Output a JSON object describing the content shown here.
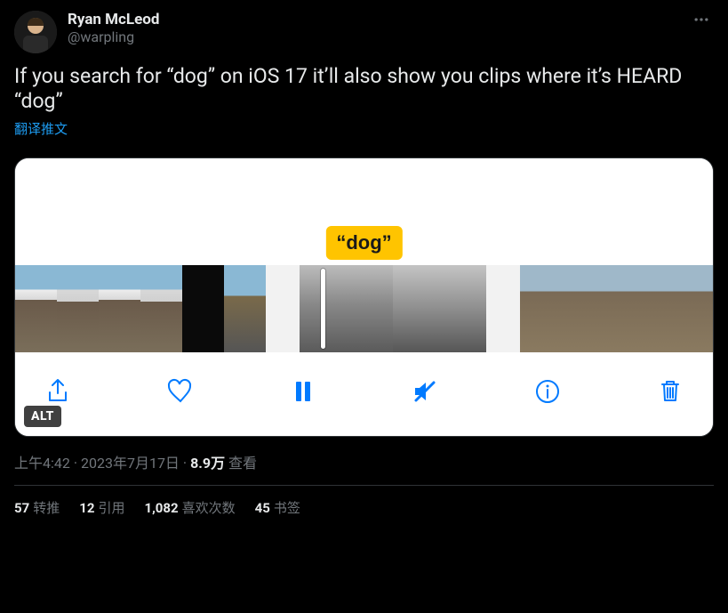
{
  "author": {
    "display_name": "Ryan McLeod",
    "handle": "@warpling"
  },
  "tweet_text": "If you search for “dog” on iOS 17 it’ll also show you clips where it’s HEARD “dog”",
  "translate_label": "翻译推文",
  "media": {
    "caption_bubble": "“dog”",
    "alt_badge": "ALT",
    "toolbar": {
      "share": "share-icon",
      "like": "heart-icon",
      "play_pause": "pause-icon",
      "mute": "mute-icon",
      "info": "info-icon",
      "trash": "trash-icon"
    }
  },
  "meta": {
    "time": "上午4:42",
    "date": "2023年7月17日",
    "views_count": "8.9万",
    "views_label": "查看"
  },
  "stats": {
    "retweets": {
      "count": "57",
      "label": "转推"
    },
    "quotes": {
      "count": "12",
      "label": "引用"
    },
    "likes": {
      "count": "1,082",
      "label": "喜欢次数"
    },
    "bookmarks": {
      "count": "45",
      "label": "书签"
    }
  }
}
